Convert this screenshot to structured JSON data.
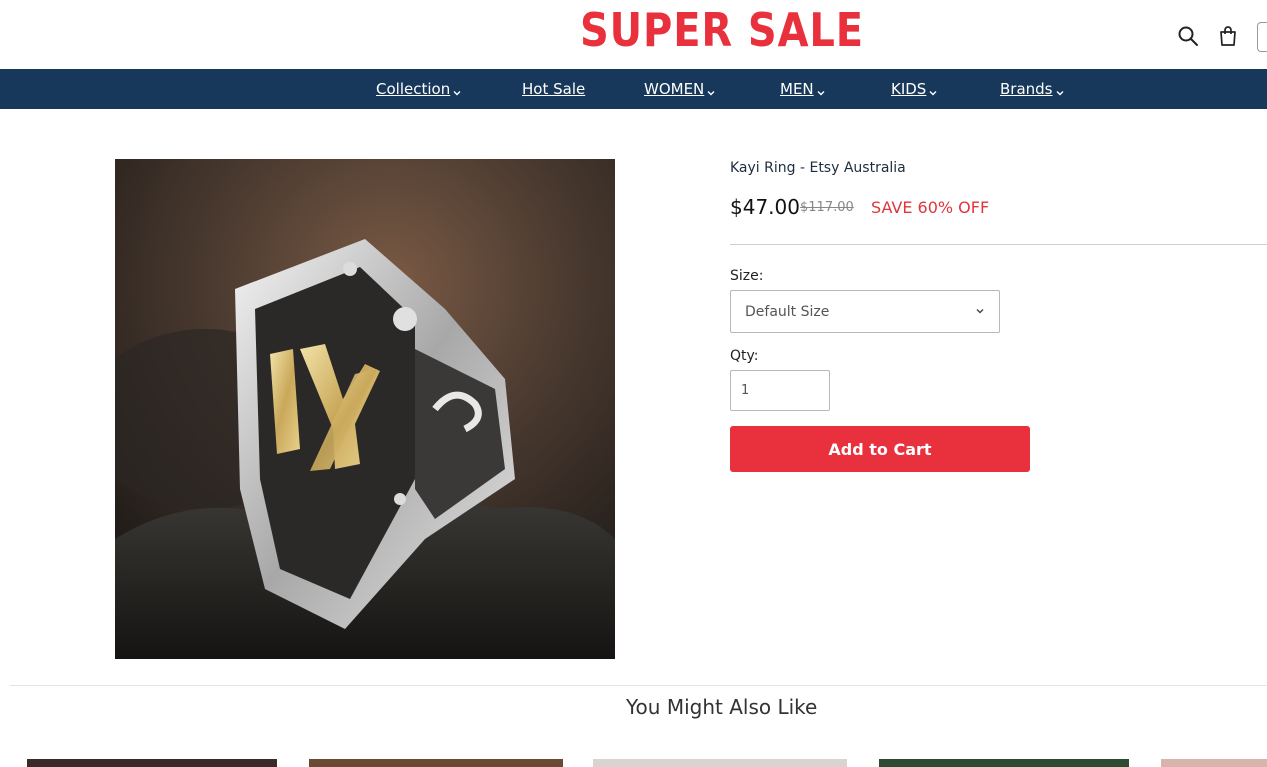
{
  "header": {
    "logo_text": "SUPER SALE",
    "search_icon": "search-icon",
    "cart_icon": "shopping-bag-icon"
  },
  "nav": {
    "items": [
      {
        "label": "Collection",
        "has_dropdown": true
      },
      {
        "label": "Hot Sale",
        "has_dropdown": false
      },
      {
        "label": "WOMEN",
        "has_dropdown": true
      },
      {
        "label": "MEN",
        "has_dropdown": true
      },
      {
        "label": "KIDS",
        "has_dropdown": true
      },
      {
        "label": "Brands",
        "has_dropdown": true
      }
    ]
  },
  "product": {
    "title": "Kayi Ring - Etsy Australia",
    "price": "$47.00",
    "compare_price": "$117.00",
    "save_text": "SAVE 60% OFF",
    "size_label": "Size:",
    "size_selected": "Default Size",
    "qty_label": "Qty:",
    "qty_value": "1",
    "add_to_cart_label": "Add to Cart"
  },
  "recommendations": {
    "title": "You Might Also Like"
  },
  "colors": {
    "brand_red": "#e8313c",
    "nav_bg": "#17385a"
  }
}
